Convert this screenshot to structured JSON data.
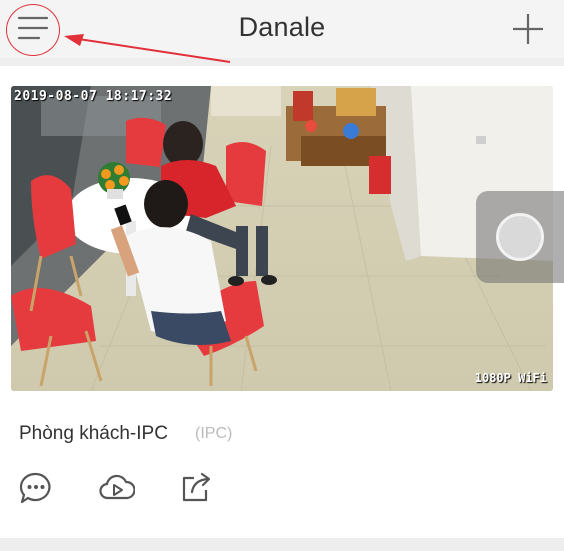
{
  "header": {
    "title": "Danale",
    "menu_icon": "hamburger-menu-icon",
    "add_icon": "plus-icon"
  },
  "camera": {
    "name": "Phòng khách-IPC",
    "type": "(IPC)",
    "timestamp": "2019-08-07 18:17:32",
    "quality": "1080P WiFi"
  },
  "actions": [
    {
      "icon": "message-icon"
    },
    {
      "icon": "cloud-play-icon"
    },
    {
      "icon": "share-icon"
    }
  ],
  "colors": {
    "annotation": "#e2303a",
    "icon": "#555555",
    "background": "#eeeeee"
  }
}
